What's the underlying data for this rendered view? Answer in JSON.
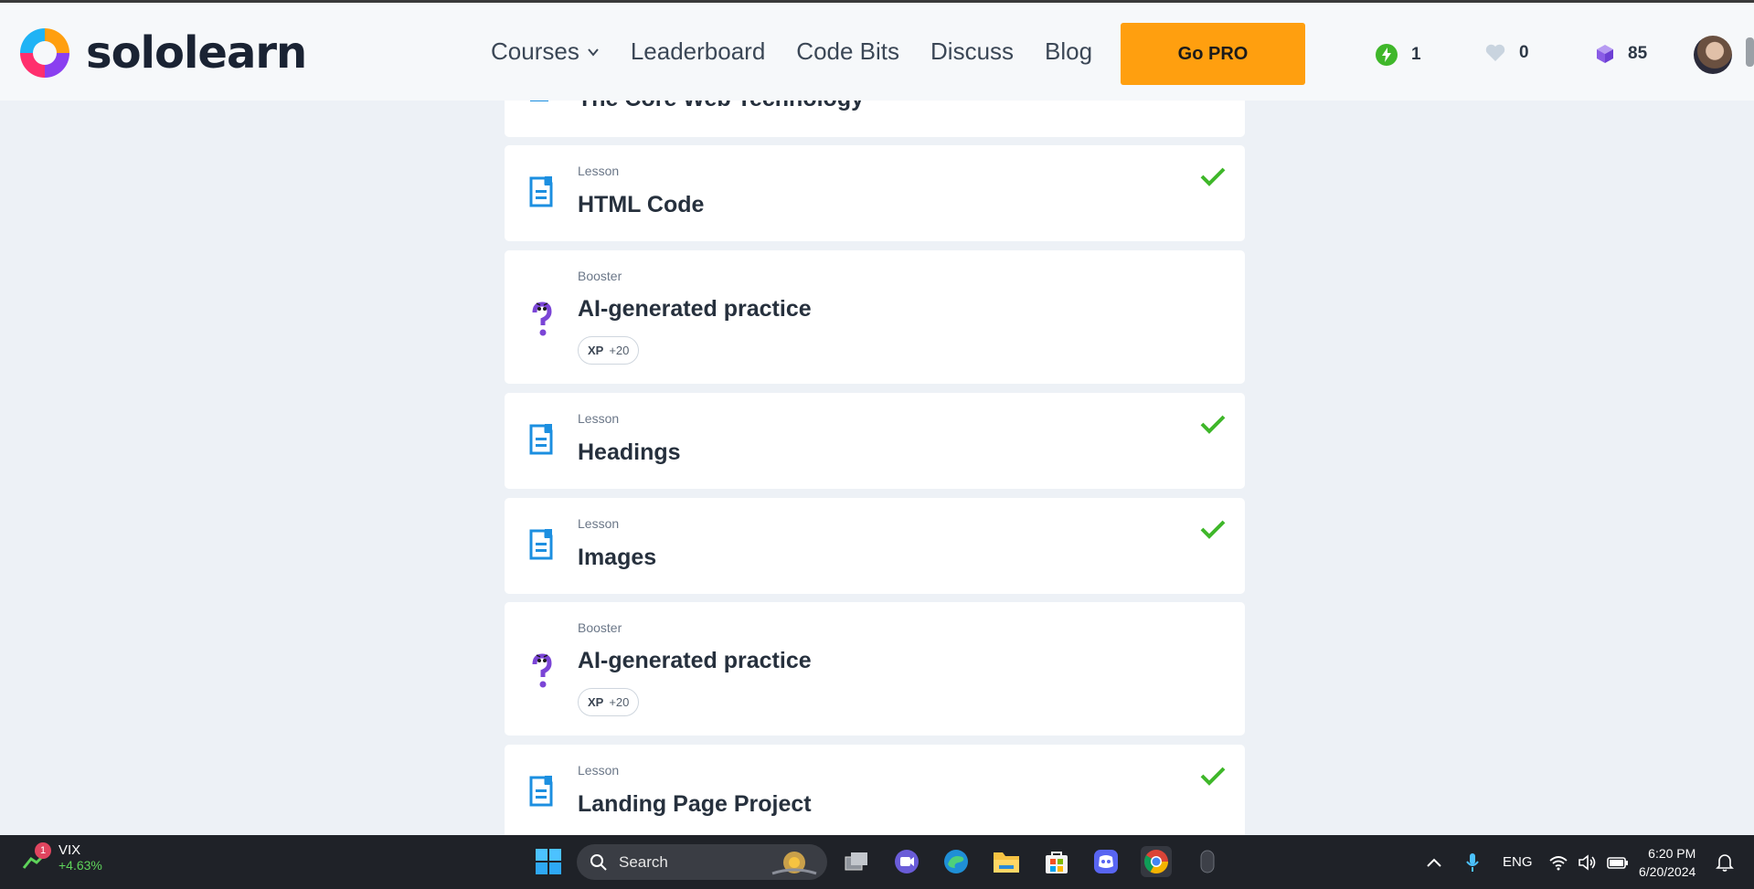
{
  "app": {
    "brand": "sololearn"
  },
  "nav": {
    "items": [
      {
        "label": "Courses"
      },
      {
        "label": "Leaderboard"
      },
      {
        "label": "Code Bits"
      },
      {
        "label": "Discuss"
      },
      {
        "label": "Blog"
      }
    ],
    "go_pro": "Go PRO",
    "stats": {
      "streak": "1",
      "hearts": "0",
      "bits": "85"
    }
  },
  "lessons": [
    {
      "kind": "",
      "title": "The Core Web Technology",
      "completed": false,
      "icon": "lesson-icon"
    },
    {
      "kind": "Lesson",
      "title": "HTML Code",
      "completed": true,
      "icon": "lesson-icon"
    },
    {
      "kind": "Booster",
      "title": "AI-generated practice",
      "completed": false,
      "icon": "question-icon",
      "xp_label": "XP",
      "xp_value": "+20"
    },
    {
      "kind": "Lesson",
      "title": "Headings",
      "completed": true,
      "icon": "lesson-icon"
    },
    {
      "kind": "Lesson",
      "title": "Images",
      "completed": true,
      "icon": "lesson-icon"
    },
    {
      "kind": "Booster",
      "title": "AI-generated practice",
      "completed": false,
      "icon": "question-icon",
      "xp_label": "XP",
      "xp_value": "+20"
    },
    {
      "kind": "Lesson",
      "title": "Landing Page Project",
      "completed": true,
      "icon": "lesson-icon"
    }
  ],
  "colors": {
    "accent_orange": "#ff9f0f",
    "check_green": "#3fb72a",
    "lesson_blue": "#1c8fe0",
    "booster_purple": "#7b45d6"
  },
  "taskbar": {
    "widget_name": "VIX",
    "widget_change": "+4.63%",
    "widget_badge": "1",
    "search_placeholder": "Search",
    "language": "ENG",
    "time": "6:20 PM",
    "date": "6/20/2024"
  }
}
